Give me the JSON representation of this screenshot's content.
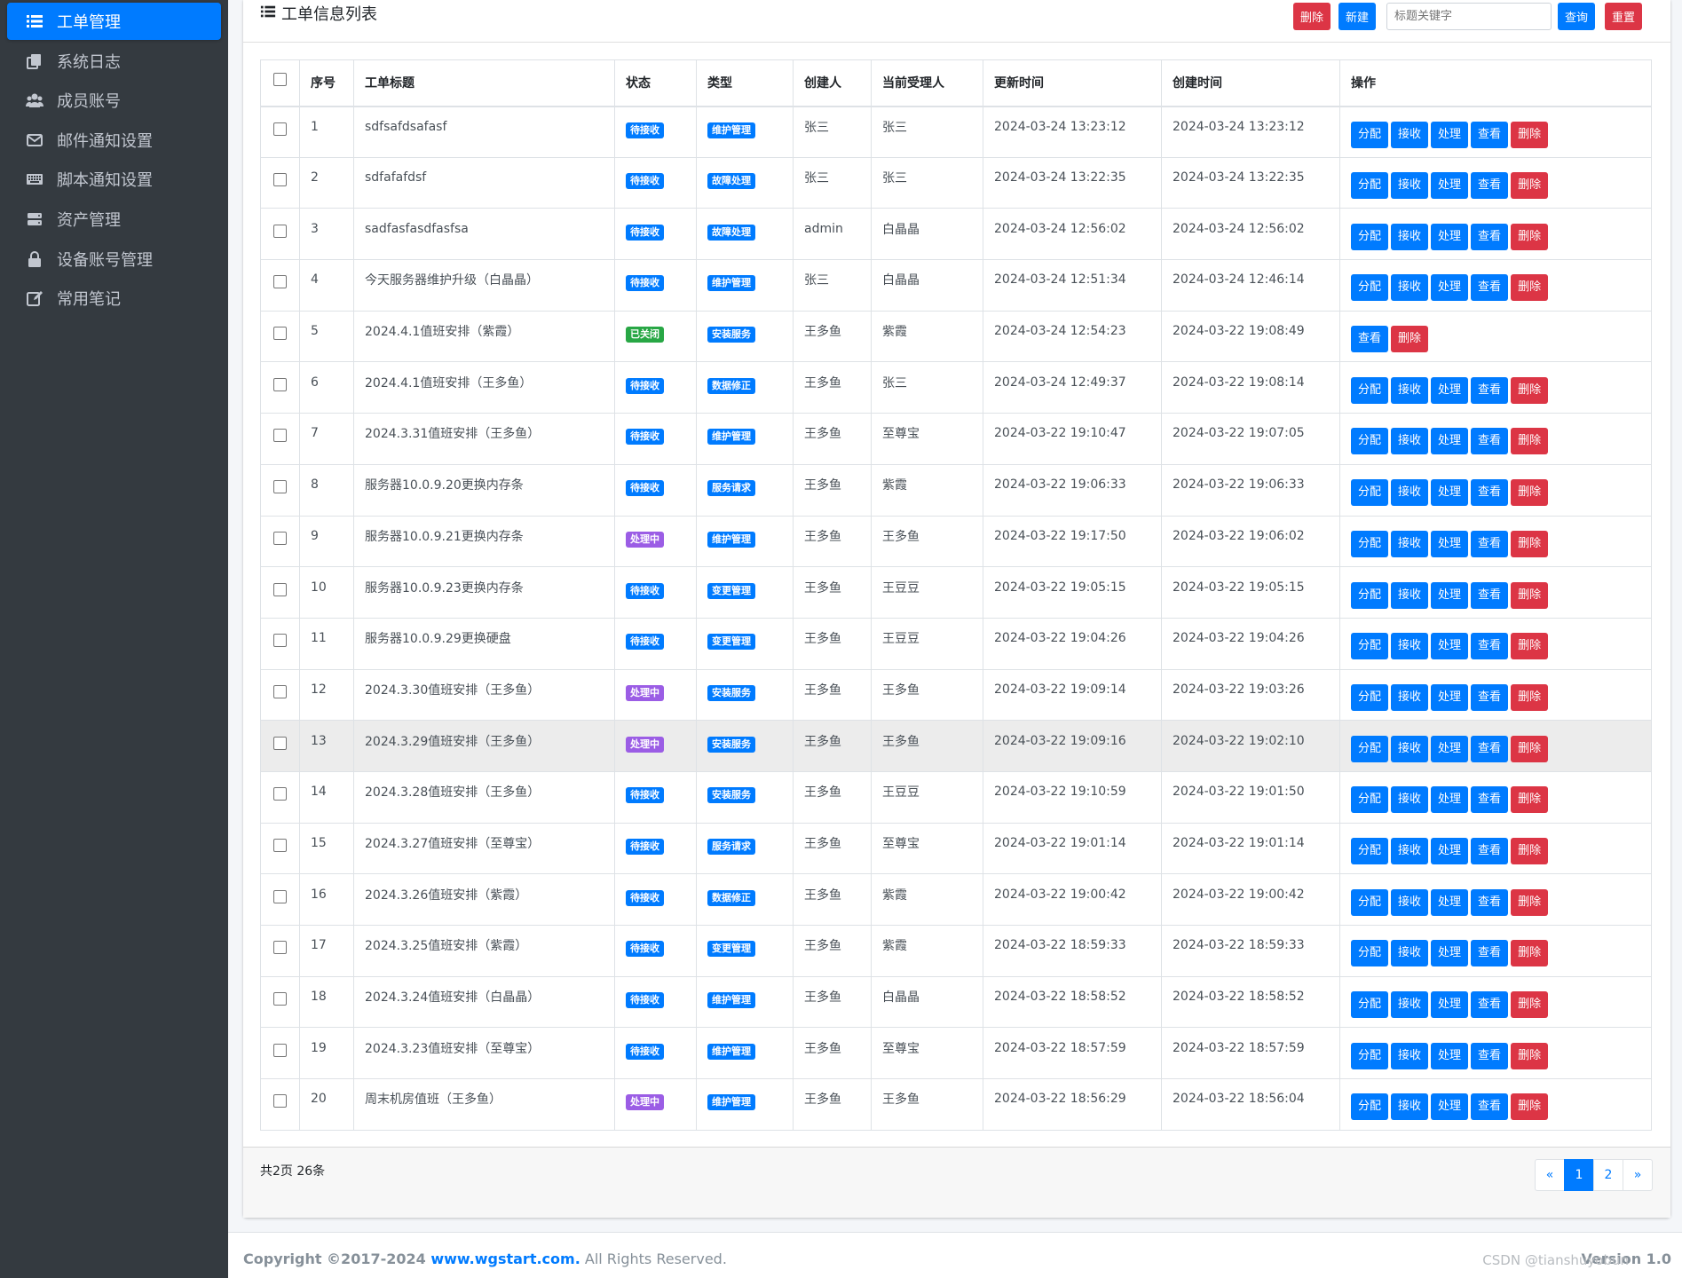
{
  "sidebar": {
    "items": [
      {
        "label": "工单管理",
        "icon": "list-icon",
        "active": true
      },
      {
        "label": "系统日志",
        "icon": "copy-icon"
      },
      {
        "label": "成员账号",
        "icon": "users-icon"
      },
      {
        "label": "邮件通知设置",
        "icon": "envelope-icon"
      },
      {
        "label": "脚本通知设置",
        "icon": "keyboard-icon"
      },
      {
        "label": "资产管理",
        "icon": "server-icon"
      },
      {
        "label": "设备账号管理",
        "icon": "lock-icon"
      },
      {
        "label": "常用笔记",
        "icon": "edit-icon"
      }
    ]
  },
  "header": {
    "title": "工单信息列表",
    "delete_label": "删除",
    "new_label": "新建",
    "search_placeholder": "标题关键字",
    "query_label": "查询",
    "reset_label": "重置"
  },
  "table": {
    "columns": [
      "序号",
      "工单标题",
      "状态",
      "类型",
      "创建人",
      "当前受理人",
      "更新时间",
      "创建时间",
      "操作"
    ],
    "actions": {
      "assign": "分配",
      "receive": "接收",
      "process": "处理",
      "view": "查看",
      "delete": "删除"
    },
    "rows": [
      {
        "no": "1",
        "title": "sdfsafdsafasf",
        "status": "待接收",
        "type": "维护管理",
        "creator": "张三",
        "assignee": "张三",
        "updated": "2024-03-24 13:23:12",
        "created": "2024-03-24 13:23:12"
      },
      {
        "no": "2",
        "title": "sdfafafdsf",
        "status": "待接收",
        "type": "故障处理",
        "creator": "张三",
        "assignee": "张三",
        "updated": "2024-03-24 13:22:35",
        "created": "2024-03-24 13:22:35"
      },
      {
        "no": "3",
        "title": "sadfasfasdfasfsa",
        "status": "待接收",
        "type": "故障处理",
        "creator": "admin",
        "assignee": "白晶晶",
        "updated": "2024-03-24 12:56:02",
        "created": "2024-03-24 12:56:02"
      },
      {
        "no": "4",
        "title": "今天服务器维护升级（白晶晶）",
        "status": "待接收",
        "type": "维护管理",
        "creator": "张三",
        "assignee": "白晶晶",
        "updated": "2024-03-24 12:51:34",
        "created": "2024-03-24 12:46:14"
      },
      {
        "no": "5",
        "title": "2024.4.1值班安排（紫霞）",
        "status": "已关闭",
        "type": "安装服务",
        "creator": "王多鱼",
        "assignee": "紫霞",
        "updated": "2024-03-24 12:54:23",
        "created": "2024-03-22 19:08:49"
      },
      {
        "no": "6",
        "title": "2024.4.1值班安排（王多鱼）",
        "status": "待接收",
        "type": "数据修正",
        "creator": "王多鱼",
        "assignee": "张三",
        "updated": "2024-03-24 12:49:37",
        "created": "2024-03-22 19:08:14"
      },
      {
        "no": "7",
        "title": "2024.3.31值班安排（王多鱼）",
        "status": "待接收",
        "type": "维护管理",
        "creator": "王多鱼",
        "assignee": "至尊宝",
        "updated": "2024-03-22 19:10:47",
        "created": "2024-03-22 19:07:05"
      },
      {
        "no": "8",
        "title": "服务器10.0.9.20更换内存条",
        "status": "待接收",
        "type": "服务请求",
        "creator": "王多鱼",
        "assignee": "紫霞",
        "updated": "2024-03-22 19:06:33",
        "created": "2024-03-22 19:06:33"
      },
      {
        "no": "9",
        "title": "服务器10.0.9.21更换内存条",
        "status": "处理中",
        "type": "维护管理",
        "creator": "王多鱼",
        "assignee": "王多鱼",
        "updated": "2024-03-22 19:17:50",
        "created": "2024-03-22 19:06:02"
      },
      {
        "no": "10",
        "title": "服务器10.0.9.23更换内存条",
        "status": "待接收",
        "type": "变更管理",
        "creator": "王多鱼",
        "assignee": "王豆豆",
        "updated": "2024-03-22 19:05:15",
        "created": "2024-03-22 19:05:15"
      },
      {
        "no": "11",
        "title": "服务器10.0.9.29更换硬盘",
        "status": "待接收",
        "type": "变更管理",
        "creator": "王多鱼",
        "assignee": "王豆豆",
        "updated": "2024-03-22 19:04:26",
        "created": "2024-03-22 19:04:26"
      },
      {
        "no": "12",
        "title": "2024.3.30值班安排（王多鱼）",
        "status": "处理中",
        "type": "安装服务",
        "creator": "王多鱼",
        "assignee": "王多鱼",
        "updated": "2024-03-22 19:09:14",
        "created": "2024-03-22 19:03:26"
      },
      {
        "no": "13",
        "title": "2024.3.29值班安排（王多鱼）",
        "status": "处理中",
        "type": "安装服务",
        "creator": "王多鱼",
        "assignee": "王多鱼",
        "updated": "2024-03-22 19:09:16",
        "created": "2024-03-22 19:02:10"
      },
      {
        "no": "14",
        "title": "2024.3.28值班安排（王多鱼）",
        "status": "待接收",
        "type": "安装服务",
        "creator": "王多鱼",
        "assignee": "王豆豆",
        "updated": "2024-03-22 19:10:59",
        "created": "2024-03-22 19:01:50"
      },
      {
        "no": "15",
        "title": "2024.3.27值班安排（至尊宝）",
        "status": "待接收",
        "type": "服务请求",
        "creator": "王多鱼",
        "assignee": "至尊宝",
        "updated": "2024-03-22 19:01:14",
        "created": "2024-03-22 19:01:14"
      },
      {
        "no": "16",
        "title": "2024.3.26值班安排（紫霞）",
        "status": "待接收",
        "type": "数据修正",
        "creator": "王多鱼",
        "assignee": "紫霞",
        "updated": "2024-03-22 19:00:42",
        "created": "2024-03-22 19:00:42"
      },
      {
        "no": "17",
        "title": "2024.3.25值班安排（紫霞）",
        "status": "待接收",
        "type": "变更管理",
        "creator": "王多鱼",
        "assignee": "紫霞",
        "updated": "2024-03-22 18:59:33",
        "created": "2024-03-22 18:59:33"
      },
      {
        "no": "18",
        "title": "2024.3.24值班安排（白晶晶）",
        "status": "待接收",
        "type": "维护管理",
        "creator": "王多鱼",
        "assignee": "白晶晶",
        "updated": "2024-03-22 18:58:52",
        "created": "2024-03-22 18:58:52"
      },
      {
        "no": "19",
        "title": "2024.3.23值班安排（至尊宝）",
        "status": "待接收",
        "type": "维护管理",
        "creator": "王多鱼",
        "assignee": "至尊宝",
        "updated": "2024-03-22 18:57:59",
        "created": "2024-03-22 18:57:59"
      },
      {
        "no": "20",
        "title": "周末机房值班（王多鱼）",
        "status": "处理中",
        "type": "维护管理",
        "creator": "王多鱼",
        "assignee": "王多鱼",
        "updated": "2024-03-22 18:56:29",
        "created": "2024-03-22 18:56:04"
      }
    ]
  },
  "pagination": {
    "summary": "共2页 26条",
    "prev": "«",
    "pages": [
      "1",
      "2"
    ],
    "current": "1",
    "next": "»"
  },
  "footer": {
    "copyright_prefix": "Copyright ©2017-2024 ",
    "site": "www.wgstart.com.",
    "rights": " All Rights Reserved.",
    "version": "Version 1.0",
    "watermark": "CSDN @tianshuyobun"
  },
  "colors": {
    "primary": "#007bff",
    "danger": "#dc3545",
    "success": "#28a745",
    "purple": "#9b5de5",
    "sidebar_bg": "#343a40"
  }
}
